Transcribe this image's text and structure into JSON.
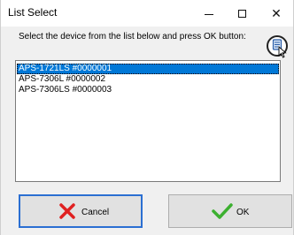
{
  "window": {
    "title": "List Select",
    "controls": {
      "minimize": "—",
      "maximize": "☐",
      "close": "✕"
    }
  },
  "dialog": {
    "instruction": "Select the device from the list below and press OK button:",
    "help_icon": "help-icon"
  },
  "devices": [
    {
      "label": "APS-1721LS #0000001",
      "selected": true
    },
    {
      "label": "APS-7306L #0000002",
      "selected": false
    },
    {
      "label": "APS-7306LS #0000003",
      "selected": false
    }
  ],
  "buttons": {
    "cancel_label": "Cancel",
    "ok_label": "OK"
  },
  "colors": {
    "selection": "#0078d7",
    "cancel_x": "#e02020",
    "ok_check": "#3cb030"
  }
}
